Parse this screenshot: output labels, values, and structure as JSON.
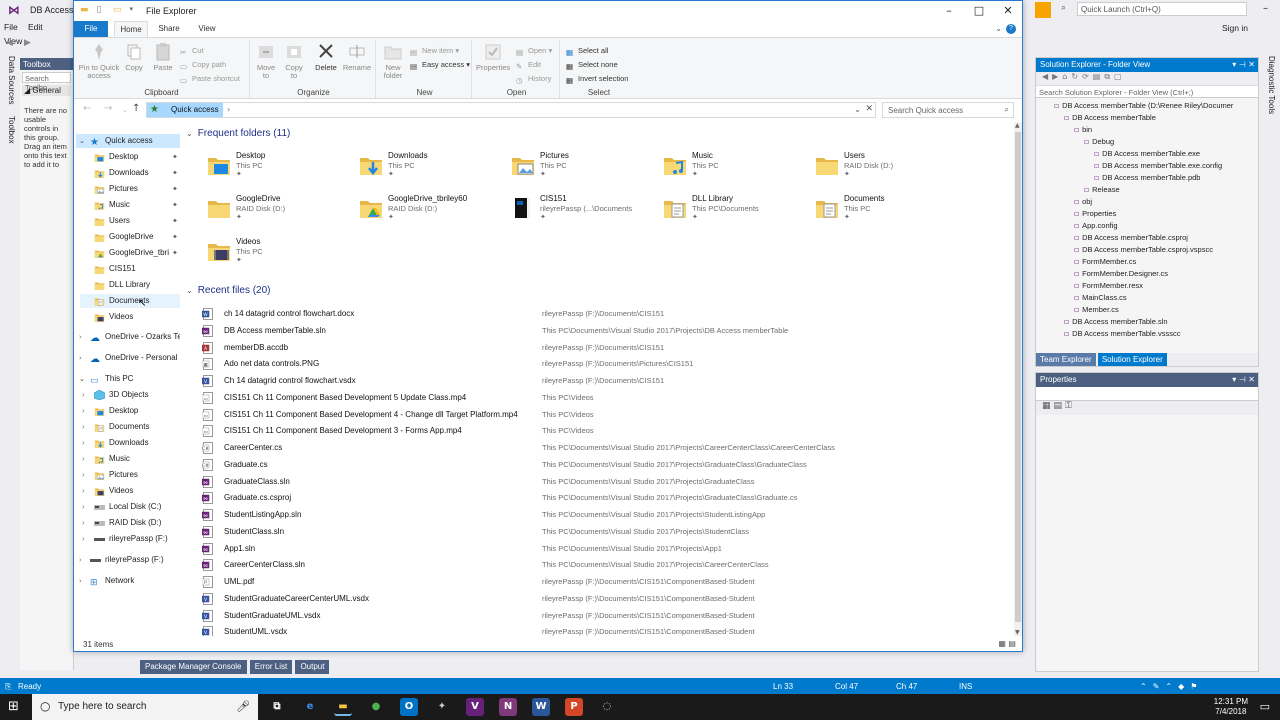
{
  "vs": {
    "title": "DB Access",
    "menu": [
      "File",
      "Edit",
      "View"
    ],
    "left_tabs": [
      "Data Sources",
      "Toolbox"
    ],
    "toolbox": {
      "title": "Toolbox",
      "search": "Search Toolbo",
      "general": "General",
      "empty_text": "There are no usable controls in this group. Drag an item onto this text to add it to"
    },
    "quick_launch": "Quick Launch (Ctrl+Q)",
    "sign_in": "Sign in",
    "solution": {
      "title": "Solution Explorer - Folder View",
      "search": "Search Solution Explorer - Folder View (Ctrl+;)",
      "tree": [
        {
          "label": "DB Access memberTable (D:\\Renee Riley\\Documer",
          "indent": 1
        },
        {
          "label": "DB Access memberTable",
          "indent": 2
        },
        {
          "label": "bin",
          "indent": 3
        },
        {
          "label": "Debug",
          "indent": 4
        },
        {
          "label": "DB Access memberTable.exe",
          "indent": 5
        },
        {
          "label": "DB Access memberTable.exe.config",
          "indent": 5
        },
        {
          "label": "DB Access memberTable.pdb",
          "indent": 5
        },
        {
          "label": "Release",
          "indent": 4
        },
        {
          "label": "obj",
          "indent": 3
        },
        {
          "label": "Properties",
          "indent": 3
        },
        {
          "label": "App.config",
          "indent": 3
        },
        {
          "label": "DB Access memberTable.csproj",
          "indent": 3
        },
        {
          "label": "DB Access memberTable.csproj.vspscc",
          "indent": 3
        },
        {
          "label": "FormMember.cs",
          "indent": 3
        },
        {
          "label": "FormMember.Designer.cs",
          "indent": 3
        },
        {
          "label": "FormMember.resx",
          "indent": 3
        },
        {
          "label": "MainClass.cs",
          "indent": 3
        },
        {
          "label": "Member.cs",
          "indent": 3
        },
        {
          "label": "DB Access memberTable.sln",
          "indent": 2
        },
        {
          "label": "DB Access memberTable.vssscc",
          "indent": 2
        }
      ],
      "tabs": [
        "Team Explorer",
        "Solution Explorer"
      ]
    },
    "properties_title": "Properties",
    "right_tabs": [
      "Diagnostic Tools"
    ],
    "bottom_tabs": [
      "Package Manager Console",
      "Error List",
      "Output"
    ],
    "status": {
      "ready": "Ready",
      "ln": "Ln 33",
      "col": "Col 47",
      "ch": "Ch 47",
      "ins": "INS"
    }
  },
  "taskbar": {
    "search_placeholder": "Type here to search",
    "time": "12:31 PM",
    "date": "7/4/2018",
    "apps": [
      {
        "name": "task-view",
        "glyph": "⧉",
        "color": "#1a1a1a",
        "fg": "#ffffff"
      },
      {
        "name": "edge",
        "glyph": "e",
        "color": "#1a1a1a",
        "fg": "#3b8ee8"
      },
      {
        "name": "file-explorer",
        "glyph": "▬",
        "color": "#1a1a1a",
        "fg": "#f4c542"
      },
      {
        "name": "chrome",
        "glyph": "●",
        "color": "#1a1a1a",
        "fg": "#4caf50"
      },
      {
        "name": "outlook",
        "glyph": "O",
        "color": "#0072c6",
        "fg": "#ffffff"
      },
      {
        "name": "app-bird",
        "glyph": "✦",
        "color": "#1a1a1a",
        "fg": "#cccccc"
      },
      {
        "name": "visual-studio",
        "glyph": "V",
        "color": "#68217a",
        "fg": "#ffffff"
      },
      {
        "name": "onenote",
        "glyph": "N",
        "color": "#80397b",
        "fg": "#ffffff"
      },
      {
        "name": "word",
        "glyph": "W",
        "color": "#2b579a",
        "fg": "#ffffff"
      },
      {
        "name": "powerpoint",
        "glyph": "P",
        "color": "#d24726",
        "fg": "#ffffff"
      },
      {
        "name": "app-other",
        "glyph": "◌",
        "color": "#1a1a1a",
        "fg": "#dddddd"
      }
    ]
  },
  "explorer": {
    "title": "File Explorer",
    "tabs": [
      "File",
      "Home",
      "Share",
      "View"
    ],
    "ribbon": {
      "clipboard": {
        "label": "Clipboard",
        "pin": "Pin to Quick access",
        "copy": "Copy",
        "paste": "Paste",
        "cut": "Cut",
        "copy_path": "Copy path",
        "paste_shortcut": "Paste shortcut"
      },
      "organize": {
        "label": "Organize",
        "move": "Move to",
        "copy": "Copy to",
        "delete": "Delete",
        "rename": "Rename"
      },
      "new": {
        "label": "New",
        "new_folder": "New folder",
        "new_item": "New item",
        "easy_access": "Easy access"
      },
      "open": {
        "label": "Open",
        "properties": "Properties",
        "open": "Open",
        "edit": "Edit",
        "history": "History"
      },
      "select": {
        "label": "Select",
        "select_all": "Select all",
        "select_none": "Select none",
        "invert": "Invert selection"
      }
    },
    "address": {
      "crumb": "Quick access",
      "search_placeholder": "Search Quick access"
    },
    "nav": {
      "quick_access": "Quick access",
      "pinned": [
        {
          "label": "Desktop",
          "icon": "desktop"
        },
        {
          "label": "Downloads",
          "icon": "download"
        },
        {
          "label": "Pictures",
          "icon": "pictures"
        },
        {
          "label": "Music",
          "icon": "music"
        },
        {
          "label": "Users",
          "icon": "folder"
        },
        {
          "label": "GoogleDrive",
          "icon": "folder"
        },
        {
          "label": "GoogleDrive_tbri",
          "icon": "gdrive"
        }
      ],
      "recent": [
        {
          "label": "CIS151",
          "icon": "folder"
        },
        {
          "label": "DLL Library",
          "icon": "folder"
        },
        {
          "label": "Documents",
          "icon": "documents"
        },
        {
          "label": "Videos",
          "icon": "videos"
        }
      ],
      "onedrive1": "OneDrive - Ozarks Te",
      "onedrive2": "OneDrive - Personal",
      "this_pc": "This PC",
      "pc_items": [
        {
          "label": "3D Objects",
          "icon": "3d"
        },
        {
          "label": "Desktop",
          "icon": "desktop"
        },
        {
          "label": "Documents",
          "icon": "documents"
        },
        {
          "label": "Downloads",
          "icon": "download"
        },
        {
          "label": "Music",
          "icon": "music"
        },
        {
          "label": "Pictures",
          "icon": "pictures"
        },
        {
          "label": "Videos",
          "icon": "videos"
        },
        {
          "label": "Local Disk (C:)",
          "icon": "disk"
        },
        {
          "label": "RAID Disk (D:)",
          "icon": "disk"
        },
        {
          "label": "rileyrePassp (F:)",
          "icon": "usb"
        }
      ],
      "usb": "rileyrePassp (F:)",
      "network": "Network"
    },
    "frequent_header": "Frequent folders (11)",
    "frequent": [
      {
        "name": "Desktop",
        "loc": "This PC",
        "icon": "desktop"
      },
      {
        "name": "Downloads",
        "loc": "This PC",
        "icon": "download"
      },
      {
        "name": "Pictures",
        "loc": "This PC",
        "icon": "pictures"
      },
      {
        "name": "Music",
        "loc": "This PC",
        "icon": "music"
      },
      {
        "name": "Users",
        "loc": "RAID Disk (D:)",
        "icon": "folder"
      },
      {
        "name": "GoogleDrive",
        "loc": "RAID Disk (D:)",
        "icon": "folder"
      },
      {
        "name": "GoogleDrive_tbriley60",
        "loc": "RAID Disk (D:)",
        "icon": "gdrive"
      },
      {
        "name": "CIS151",
        "loc": "rileyrePassp (...\\Documents",
        "icon": "book"
      },
      {
        "name": "DLL Library",
        "loc": "This PC\\Documents",
        "icon": "folder-doc"
      },
      {
        "name": "Documents",
        "loc": "This PC",
        "icon": "documents"
      },
      {
        "name": "Videos",
        "loc": "This PC",
        "icon": "videos"
      }
    ],
    "recent_header": "Recent files (20)",
    "recent": [
      {
        "name": "ch 14 datagrid control flowchart.docx",
        "path": "rileyrePassp (F:)\\Documents\\CIS151",
        "icon": "word"
      },
      {
        "name": "DB Access memberTable.sln",
        "path": "This PC\\Documents\\Visual Studio 2017\\Projects\\DB Access memberTable",
        "icon": "vs"
      },
      {
        "name": "memberDB.accdb",
        "path": "rileyrePassp (F:)\\Documents\\CIS151",
        "icon": "access"
      },
      {
        "name": "Ado net data controls.PNG",
        "path": "rileyrePassp (F:)\\Documents\\Pictures\\CIS151",
        "icon": "image"
      },
      {
        "name": "Ch 14 datagrid control flowchart.vsdx",
        "path": "rileyrePassp (F:)\\Documents\\CIS151",
        "icon": "visio"
      },
      {
        "name": "CIS151 Ch 11 Component Based Development 5 Update Class.mp4",
        "path": "This PC\\Videos",
        "icon": "video"
      },
      {
        "name": "CIS151 Ch 11 Component Based Development 4 - Change dll Target Platform.mp4",
        "path": "This PC\\Videos",
        "icon": "video"
      },
      {
        "name": "CIS151 Ch 11 Component Based Development 3 - Forms App.mp4",
        "path": "This PC\\Videos",
        "icon": "video"
      },
      {
        "name": "CareerCenter.cs",
        "path": "This PC\\Documents\\Visual Studio 2017\\Projects\\CareerCenterClass\\CareerCenterClass",
        "icon": "cs"
      },
      {
        "name": "Graduate.cs",
        "path": "This PC\\Documents\\Visual Studio 2017\\Projects\\GraduateClass\\GraduateClass",
        "icon": "cs"
      },
      {
        "name": "GraduateClass.sln",
        "path": "This PC\\Documents\\Visual Studio 2017\\Projects\\GraduateClass",
        "icon": "vs"
      },
      {
        "name": "Graduate.cs.csproj",
        "path": "This PC\\Documents\\Visual Studio 2017\\Projects\\GraduateClass\\Graduate.cs",
        "icon": "vs"
      },
      {
        "name": "StudentListingApp.sln",
        "path": "This PC\\Documents\\Visual Studio 2017\\Projects\\StudentListingApp",
        "icon": "vs"
      },
      {
        "name": "StudentClass.sln",
        "path": "This PC\\Documents\\Visual Studio 2017\\Projects\\StudentClass",
        "icon": "vs"
      },
      {
        "name": "App1.sln",
        "path": "This PC\\Documents\\Visual Studio 2017\\Projects\\App1",
        "icon": "vs"
      },
      {
        "name": "CareerCenterClass.sln",
        "path": "This PC\\Documents\\Visual Studio 2017\\Projects\\CareerCenterClass",
        "icon": "vs"
      },
      {
        "name": "UML.pdf",
        "path": "rileyrePassp (F:)\\Documents\\CIS151\\ComponentBased-Student",
        "icon": "pdf"
      },
      {
        "name": "StudentGraduateCareerCenterUML.vsdx",
        "path": "rileyrePassp (F:)\\Documents\\CIS151\\ComponentBased-Student",
        "icon": "visio"
      },
      {
        "name": "StudentGraduateUML.vsdx",
        "path": "rileyrePassp (F:)\\Documents\\CIS151\\ComponentBased-Student",
        "icon": "visio"
      },
      {
        "name": "StudentUML.vsdx",
        "path": "rileyrePassp (F:)\\Documents\\CIS151\\ComponentBased-Student",
        "icon": "visio"
      }
    ],
    "status": "31 items"
  },
  "colors": {
    "folder": "#f8d775",
    "folder_dark": "#e8b84a",
    "accent": "#1979ca",
    "selected": "#cce8ff",
    "vs_blue": "#007acc"
  }
}
